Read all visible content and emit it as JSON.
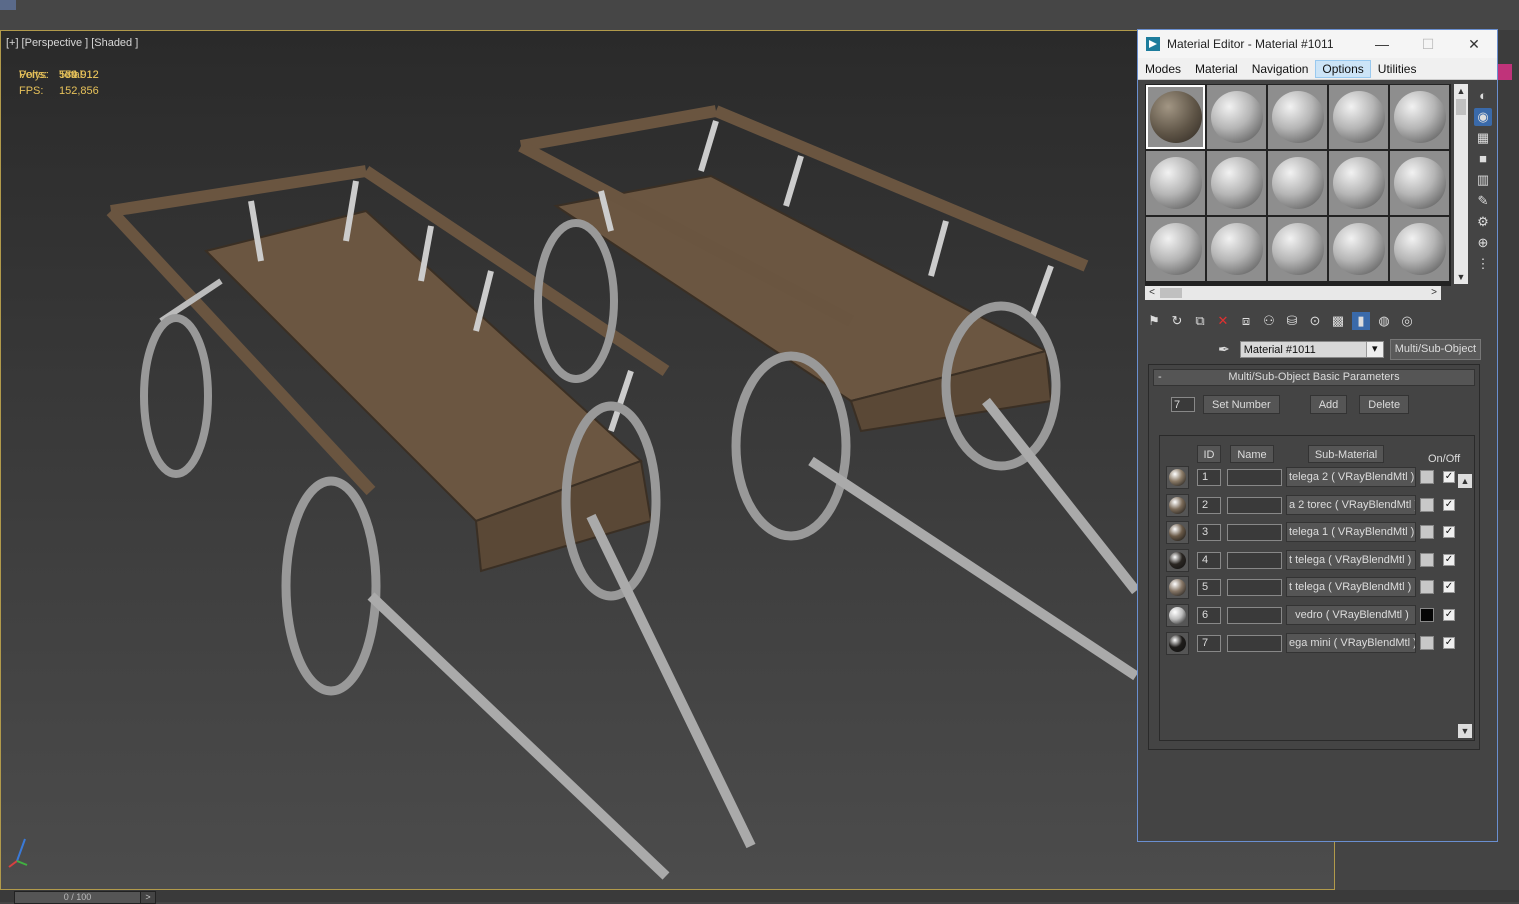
{
  "viewport": {
    "label_parts": [
      "[+]",
      "[Perspective ]",
      "[Shaded ]"
    ],
    "stats": {
      "header": "Total",
      "polys_label": "Polys:",
      "polys_value": "579 912",
      "verts_label": "Verts:",
      "verts_value": "584 912",
      "fps_label": "FPS:",
      "fps_value": "152,856"
    }
  },
  "timeline": {
    "slider_text": "0 / 100",
    "arrow": ">"
  },
  "material_editor": {
    "title": "Material Editor - Material #1011",
    "window_buttons": {
      "minimize": "—",
      "maximize": "☐",
      "close": "✕"
    },
    "menu": [
      "Modes",
      "Material",
      "Navigation",
      "Options",
      "Utilities"
    ],
    "active_menu": "Options",
    "material_name": "Material #1011",
    "material_type": "Multi/Sub-Object",
    "rollout_title": "Multi/Sub-Object Basic Parameters",
    "rollout_toggle": "-",
    "count_value": "7",
    "buttons": {
      "set_number": "Set Number",
      "add": "Add",
      "delete": "Delete"
    },
    "columns": {
      "id": "ID",
      "name": "Name",
      "sub_material": "Sub-Material",
      "on_off": "On/Off"
    },
    "rows": [
      {
        "id": "1",
        "sub": "telega 2  ( VRayBlendMtl )",
        "color": "#c8c8c8",
        "on": true,
        "swatch": "#8a7a66"
      },
      {
        "id": "2",
        "sub": "a 2 torec  ( VRayBlendMtl )",
        "color": "#c8c8c8",
        "on": true,
        "swatch": "#7a6a58"
      },
      {
        "id": "3",
        "sub": "telega 1  ( VRayBlendMtl )",
        "color": "#c8c8c8",
        "on": true,
        "swatch": "#6a5a48"
      },
      {
        "id": "4",
        "sub": "t telega  ( VRayBlendMtl )",
        "color": "#c8c8c8",
        "on": true,
        "swatch": "#2a2622"
      },
      {
        "id": "5",
        "sub": "t telega  ( VRayBlendMtl )",
        "color": "#c8c8c8",
        "on": true,
        "swatch": "#857565"
      },
      {
        "id": "6",
        "sub": "vedro  ( VRayBlendMtl )",
        "color": "#050505",
        "on": true,
        "swatch": "#bcbcbc"
      },
      {
        "id": "7",
        "sub": "ega mini  ( VRayBlendMtl )",
        "color": "#c8c8c8",
        "on": true,
        "swatch": "#1e1c1a"
      }
    ],
    "check_glyph": "✓"
  }
}
